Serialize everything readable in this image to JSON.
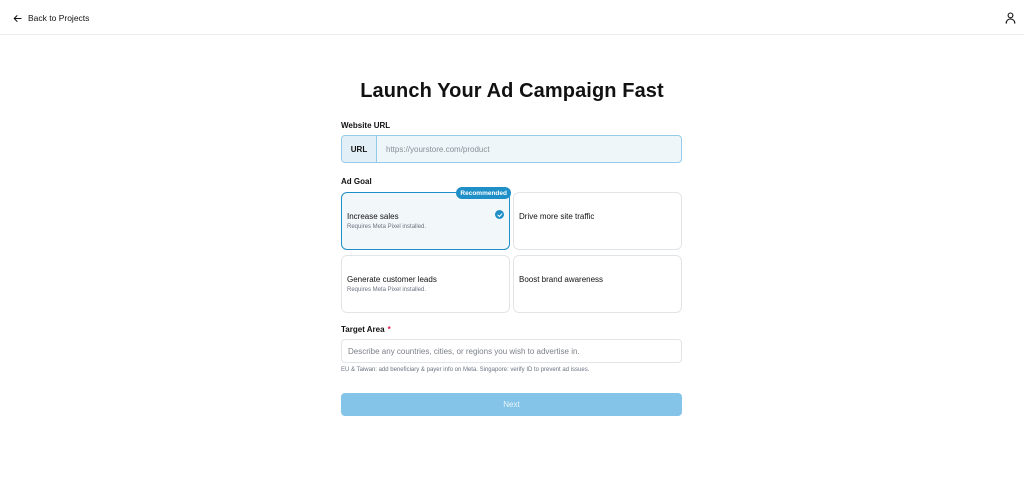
{
  "header": {
    "back_label": "Back to Projects"
  },
  "title": "Launch Your Ad Campaign Fast",
  "website_url": {
    "label": "Website URL",
    "prefix": "URL",
    "placeholder": "https://yourstore.com/product",
    "value": ""
  },
  "ad_goal": {
    "label": "Ad Goal",
    "options": [
      {
        "title": "Increase sales",
        "subtitle": "Requires Meta Pixel installed.",
        "badge": "Recommended",
        "selected": true
      },
      {
        "title": "Drive more site traffic",
        "subtitle": "",
        "selected": false
      },
      {
        "title": "Generate customer leads",
        "subtitle": "Requires Meta Pixel installed.",
        "selected": false
      },
      {
        "title": "Boost brand awareness",
        "subtitle": "",
        "selected": false
      }
    ]
  },
  "target_area": {
    "label": "Target Area",
    "required_mark": "*",
    "placeholder": "Describe any countries, cities, or regions you wish to advertise in.",
    "value": "",
    "hint": "EU & Taiwan: add beneficiary & payer info on Meta. Singapore: verify ID to prevent ad issues."
  },
  "next_label": "Next",
  "colors": {
    "accent": "#1f8fc8",
    "next_button": "#84c4e8"
  }
}
